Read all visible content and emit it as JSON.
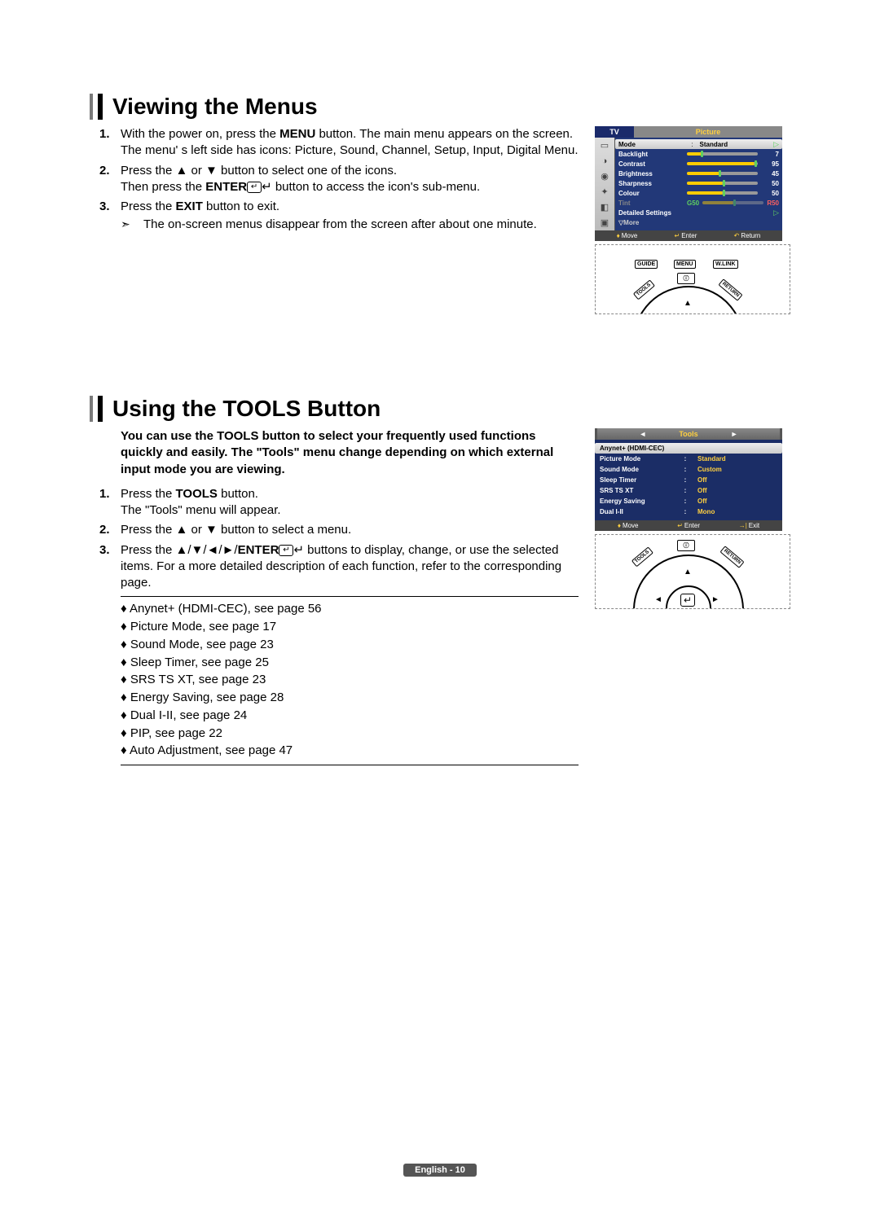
{
  "section1": {
    "heading": "Viewing the Menus",
    "steps": [
      {
        "num": "1.",
        "lines": [
          [
            "With the power on, press the ",
            "MENU",
            " button."
          ],
          [
            "The main menu appears on the screen. The menu' s left side has icons: Picture, Sound, Channel, Setup, Input, Digital Menu."
          ]
        ]
      },
      {
        "num": "2.",
        "lines": [
          [
            "Press the ▲ or ▼ button to select one of the icons."
          ],
          [
            "Then press the ",
            "ENTER",
            "↵ button to access the icon's sub-menu."
          ]
        ]
      },
      {
        "num": "3.",
        "lines": [
          [
            "Press the ",
            "EXIT",
            " button to exit."
          ]
        ],
        "note": "The on-screen menus disappear from the screen after about one minute."
      }
    ],
    "osd": {
      "tv": "TV",
      "title": "Picture",
      "rows": {
        "mode": {
          "label": "Mode",
          "value": "Standard"
        },
        "backlight": {
          "label": "Backlight",
          "value": "7",
          "pct": 20
        },
        "contrast": {
          "label": "Contrast",
          "value": "95",
          "pct": 95
        },
        "brightness": {
          "label": "Brightness",
          "value": "45",
          "pct": 45
        },
        "sharpness": {
          "label": "Sharpness",
          "value": "50",
          "pct": 50
        },
        "colour": {
          "label": "Colour",
          "value": "50",
          "pct": 50
        },
        "tint": {
          "label": "Tint",
          "g": "G50",
          "r": "R50"
        },
        "detailed": {
          "label": "Detailed Settings"
        },
        "more": {
          "label": "▽More"
        }
      },
      "footer": {
        "move": "Move",
        "enter": "Enter",
        "return": "Return"
      },
      "remote_buttons": {
        "guide": "GUIDE",
        "menu": "MENU",
        "wlink": "W.LINK",
        "tools": "TOOLS",
        "return": "RETURN"
      }
    }
  },
  "section2": {
    "heading": "Using the TOOLS Button",
    "intro": "You can use the TOOLS button to select your frequently used functions quickly and easily. The \"Tools\" menu change depending on which external input mode you are viewing.",
    "steps": [
      {
        "num": "1.",
        "lines": [
          [
            "Press the ",
            "TOOLS",
            " button."
          ],
          [
            "The \"Tools\" menu will appear."
          ]
        ]
      },
      {
        "num": "2.",
        "lines": [
          [
            "Press the ▲ or ▼ button to select a menu."
          ]
        ]
      },
      {
        "num": "3.",
        "lines": [
          [
            "Press the ▲/▼/◄/►/",
            "ENTER",
            "↵ buttons to display, change, or use the selected items. For a more detailed description of each function, refer to the corresponding page."
          ]
        ]
      }
    ],
    "refs": [
      "Anynet+ (HDMI-CEC), see page 56",
      "Picture Mode, see page 17",
      "Sound Mode, see page 23",
      "Sleep Timer, see page 25",
      "SRS TS XT, see page 23",
      "Energy Saving, see page 28",
      "Dual I-II, see page 24",
      "PIP, see page 22",
      "Auto Adjustment, see page 47"
    ],
    "tools_osd": {
      "title": "Tools",
      "rows": [
        {
          "l": "Anynet+ (HDMI-CEC)",
          "v": "",
          "sel": true
        },
        {
          "l": "Picture Mode",
          "v": "Standard"
        },
        {
          "l": "Sound Mode",
          "v": "Custom"
        },
        {
          "l": "Sleep Timer",
          "v": "Off"
        },
        {
          "l": "SRS TS XT",
          "v": "Off"
        },
        {
          "l": "Energy Saving",
          "v": "Off"
        },
        {
          "l": "Dual I-II",
          "v": "Mono"
        }
      ],
      "footer": {
        "move": "Move",
        "enter": "Enter",
        "exit": "Exit"
      },
      "remote_buttons": {
        "tools": "TOOLS",
        "return": "RETURN"
      }
    }
  },
  "footer": "English - 10"
}
